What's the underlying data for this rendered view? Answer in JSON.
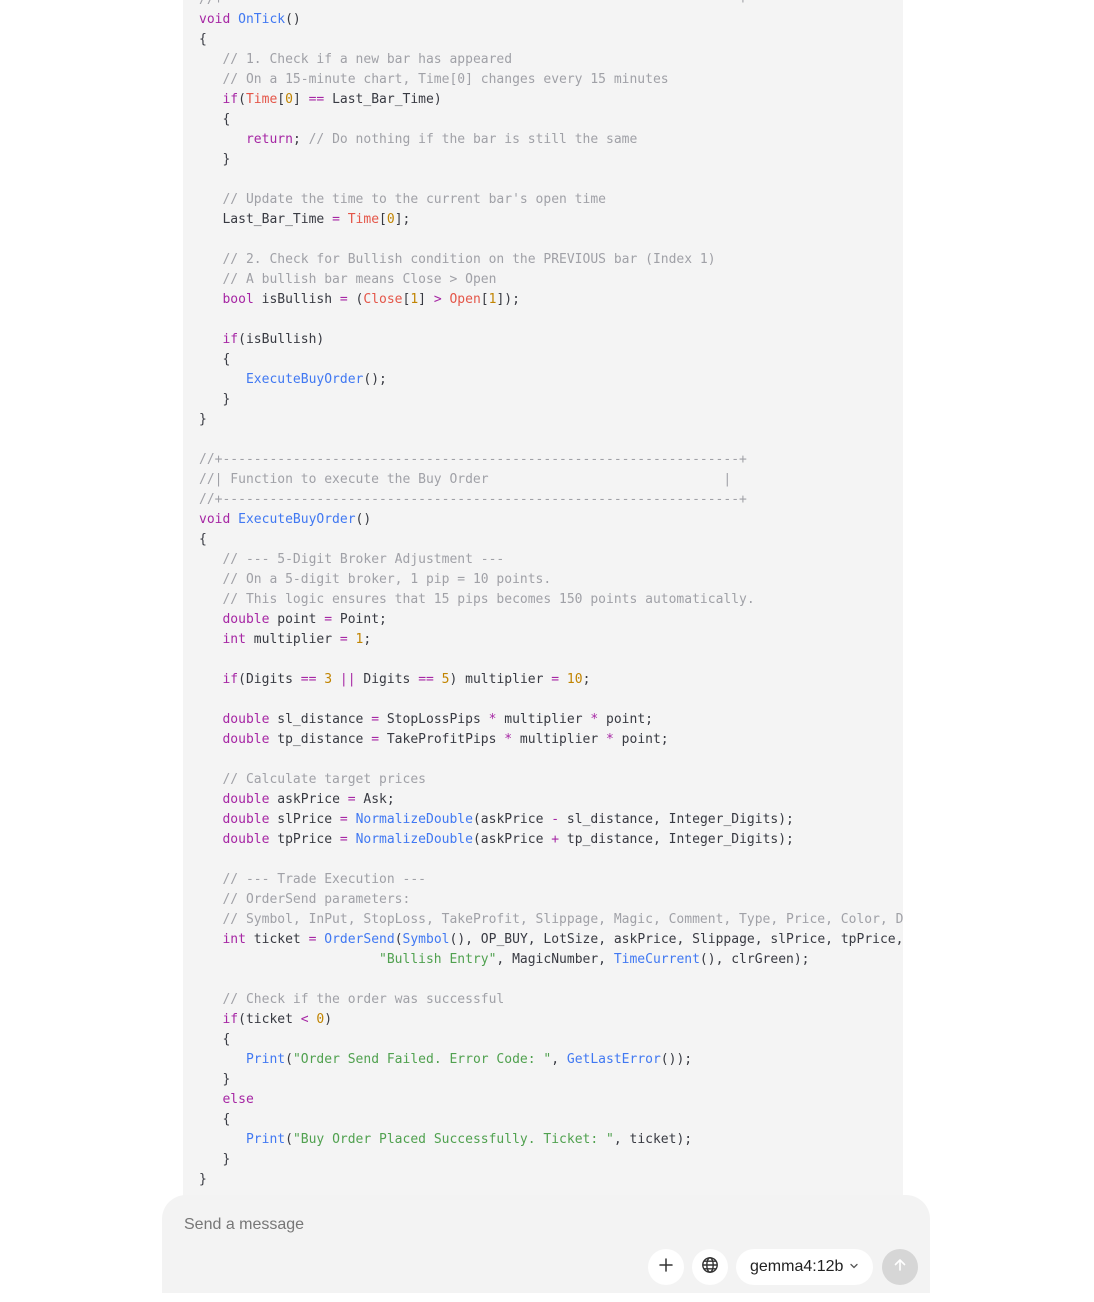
{
  "code_lines": [
    [
      [
        "c",
        "//+------------------------------------------------------------------+"
      ]
    ],
    [
      [
        "k",
        "void"
      ],
      [
        "t",
        " "
      ],
      [
        "f",
        "OnTick"
      ],
      [
        "t",
        "()"
      ]
    ],
    [
      [
        "t",
        "{"
      ]
    ],
    [
      [
        "t",
        "   "
      ],
      [
        "c",
        "// 1. Check if a new bar has appeared"
      ]
    ],
    [
      [
        "t",
        "   "
      ],
      [
        "c",
        "// On a 15-minute chart, Time[0] changes every 15 minutes"
      ]
    ],
    [
      [
        "t",
        "   "
      ],
      [
        "k",
        "if"
      ],
      [
        "t",
        "("
      ],
      [
        "v",
        "Time"
      ],
      [
        "t",
        "["
      ],
      [
        "n",
        "0"
      ],
      [
        "t",
        "] "
      ],
      [
        "o",
        "=="
      ],
      [
        "t",
        " Last_Bar_Time)"
      ]
    ],
    [
      [
        "t",
        "   {"
      ]
    ],
    [
      [
        "t",
        "      "
      ],
      [
        "k",
        "return"
      ],
      [
        "t",
        "; "
      ],
      [
        "c",
        "// Do nothing if the bar is still the same"
      ]
    ],
    [
      [
        "t",
        "   }"
      ]
    ],
    [
      [
        "t",
        ""
      ]
    ],
    [
      [
        "t",
        "   "
      ],
      [
        "c",
        "// Update the time to the current bar's open time"
      ]
    ],
    [
      [
        "t",
        "   Last_Bar_Time "
      ],
      [
        "o",
        "="
      ],
      [
        "t",
        " "
      ],
      [
        "v",
        "Time"
      ],
      [
        "t",
        "["
      ],
      [
        "n",
        "0"
      ],
      [
        "t",
        "];"
      ]
    ],
    [
      [
        "t",
        ""
      ]
    ],
    [
      [
        "t",
        "   "
      ],
      [
        "c",
        "// 2. Check for Bullish condition on the PREVIOUS bar (Index 1)"
      ]
    ],
    [
      [
        "t",
        "   "
      ],
      [
        "c",
        "// A bullish bar means Close > Open"
      ]
    ],
    [
      [
        "t",
        "   "
      ],
      [
        "k",
        "bool"
      ],
      [
        "t",
        " isBullish "
      ],
      [
        "o",
        "="
      ],
      [
        "t",
        " ("
      ],
      [
        "v",
        "Close"
      ],
      [
        "t",
        "["
      ],
      [
        "n",
        "1"
      ],
      [
        "t",
        "] "
      ],
      [
        "o",
        ">"
      ],
      [
        "t",
        " "
      ],
      [
        "v",
        "Open"
      ],
      [
        "t",
        "["
      ],
      [
        "n",
        "1"
      ],
      [
        "t",
        "]);"
      ]
    ],
    [
      [
        "t",
        ""
      ]
    ],
    [
      [
        "t",
        "   "
      ],
      [
        "k",
        "if"
      ],
      [
        "t",
        "(isBullish)"
      ]
    ],
    [
      [
        "t",
        "   {"
      ]
    ],
    [
      [
        "t",
        "      "
      ],
      [
        "f",
        "ExecuteBuyOrder"
      ],
      [
        "t",
        "();"
      ]
    ],
    [
      [
        "t",
        "   }"
      ]
    ],
    [
      [
        "t",
        "}"
      ]
    ],
    [
      [
        "t",
        ""
      ]
    ],
    [
      [
        "c",
        "//+------------------------------------------------------------------+"
      ]
    ],
    [
      [
        "c",
        "//| Function to execute the Buy Order                              |"
      ]
    ],
    [
      [
        "c",
        "//+------------------------------------------------------------------+"
      ]
    ],
    [
      [
        "k",
        "void"
      ],
      [
        "t",
        " "
      ],
      [
        "f",
        "ExecuteBuyOrder"
      ],
      [
        "t",
        "()"
      ]
    ],
    [
      [
        "t",
        "{"
      ]
    ],
    [
      [
        "t",
        "   "
      ],
      [
        "c",
        "// --- 5-Digit Broker Adjustment ---"
      ]
    ],
    [
      [
        "t",
        "   "
      ],
      [
        "c",
        "// On a 5-digit broker, 1 pip = 10 points."
      ]
    ],
    [
      [
        "t",
        "   "
      ],
      [
        "c",
        "// This logic ensures that 15 pips becomes 150 points automatically."
      ]
    ],
    [
      [
        "t",
        "   "
      ],
      [
        "k",
        "double"
      ],
      [
        "t",
        " point "
      ],
      [
        "o",
        "="
      ],
      [
        "t",
        " Point;"
      ]
    ],
    [
      [
        "t",
        "   "
      ],
      [
        "k",
        "int"
      ],
      [
        "t",
        " multiplier "
      ],
      [
        "o",
        "="
      ],
      [
        "t",
        " "
      ],
      [
        "n",
        "1"
      ],
      [
        "t",
        ";"
      ]
    ],
    [
      [
        "t",
        ""
      ]
    ],
    [
      [
        "t",
        "   "
      ],
      [
        "k",
        "if"
      ],
      [
        "t",
        "(Digits "
      ],
      [
        "o",
        "=="
      ],
      [
        "t",
        " "
      ],
      [
        "n",
        "3"
      ],
      [
        "t",
        " "
      ],
      [
        "o",
        "||"
      ],
      [
        "t",
        " Digits "
      ],
      [
        "o",
        "=="
      ],
      [
        "t",
        " "
      ],
      [
        "n",
        "5"
      ],
      [
        "t",
        ") multiplier "
      ],
      [
        "o",
        "="
      ],
      [
        "t",
        " "
      ],
      [
        "n",
        "10"
      ],
      [
        "t",
        ";"
      ]
    ],
    [
      [
        "t",
        ""
      ]
    ],
    [
      [
        "t",
        "   "
      ],
      [
        "k",
        "double"
      ],
      [
        "t",
        " sl_distance "
      ],
      [
        "o",
        "="
      ],
      [
        "t",
        " StopLossPips "
      ],
      [
        "o",
        "*"
      ],
      [
        "t",
        " multiplier "
      ],
      [
        "o",
        "*"
      ],
      [
        "t",
        " point;"
      ]
    ],
    [
      [
        "t",
        "   "
      ],
      [
        "k",
        "double"
      ],
      [
        "t",
        " tp_distance "
      ],
      [
        "o",
        "="
      ],
      [
        "t",
        " TakeProfitPips "
      ],
      [
        "o",
        "*"
      ],
      [
        "t",
        " multiplier "
      ],
      [
        "o",
        "*"
      ],
      [
        "t",
        " point;"
      ]
    ],
    [
      [
        "t",
        ""
      ]
    ],
    [
      [
        "t",
        "   "
      ],
      [
        "c",
        "// Calculate target prices"
      ]
    ],
    [
      [
        "t",
        "   "
      ],
      [
        "k",
        "double"
      ],
      [
        "t",
        " askPrice "
      ],
      [
        "o",
        "="
      ],
      [
        "t",
        " Ask;"
      ]
    ],
    [
      [
        "t",
        "   "
      ],
      [
        "k",
        "double"
      ],
      [
        "t",
        " slPrice "
      ],
      [
        "o",
        "="
      ],
      [
        "t",
        " "
      ],
      [
        "f",
        "NormalizeDouble"
      ],
      [
        "t",
        "(askPrice "
      ],
      [
        "o",
        "-"
      ],
      [
        "t",
        " sl_distance, Integer_Digits);"
      ]
    ],
    [
      [
        "t",
        "   "
      ],
      [
        "k",
        "double"
      ],
      [
        "t",
        " tpPrice "
      ],
      [
        "o",
        "="
      ],
      [
        "t",
        " "
      ],
      [
        "f",
        "NormalizeDouble"
      ],
      [
        "t",
        "(askPrice "
      ],
      [
        "o",
        "+"
      ],
      [
        "t",
        " tp_distance, Integer_Digits);"
      ]
    ],
    [
      [
        "t",
        ""
      ]
    ],
    [
      [
        "t",
        "   "
      ],
      [
        "c",
        "// --- Trade Execution ---"
      ]
    ],
    [
      [
        "t",
        "   "
      ],
      [
        "c",
        "// OrderSend parameters:"
      ]
    ],
    [
      [
        "t",
        "   "
      ],
      [
        "c",
        "// Symbol, InPut, StopLoss, TakeProfit, Slippage, Magic, Comment, Type, Price, Color, Dur"
      ]
    ],
    [
      [
        "t",
        "   "
      ],
      [
        "k",
        "int"
      ],
      [
        "t",
        " ticket "
      ],
      [
        "o",
        "="
      ],
      [
        "t",
        " "
      ],
      [
        "f",
        "OrderSend"
      ],
      [
        "t",
        "("
      ],
      [
        "f",
        "Symbol"
      ],
      [
        "t",
        "(), OP_BUY, LotSize, askPrice, Slippage, slPrice, tpPrice,"
      ]
    ],
    [
      [
        "t",
        "                       "
      ],
      [
        "s",
        "\"Bullish Entry\""
      ],
      [
        "t",
        ", MagicNumber, "
      ],
      [
        "f",
        "TimeCurrent"
      ],
      [
        "t",
        "(), clrGreen);"
      ]
    ],
    [
      [
        "t",
        ""
      ]
    ],
    [
      [
        "t",
        "   "
      ],
      [
        "c",
        "// Check if the order was successful"
      ]
    ],
    [
      [
        "t",
        "   "
      ],
      [
        "k",
        "if"
      ],
      [
        "t",
        "(ticket "
      ],
      [
        "o",
        "<"
      ],
      [
        "t",
        " "
      ],
      [
        "n",
        "0"
      ],
      [
        "t",
        ")"
      ]
    ],
    [
      [
        "t",
        "   {"
      ]
    ],
    [
      [
        "t",
        "      "
      ],
      [
        "f",
        "Print"
      ],
      [
        "t",
        "("
      ],
      [
        "s",
        "\"Order Send Failed. Error Code: \""
      ],
      [
        "t",
        ", "
      ],
      [
        "f",
        "GetLastError"
      ],
      [
        "t",
        "());"
      ]
    ],
    [
      [
        "t",
        "   }"
      ]
    ],
    [
      [
        "t",
        "   "
      ],
      [
        "k",
        "else"
      ]
    ],
    [
      [
        "t",
        "   {"
      ]
    ],
    [
      [
        "t",
        "      "
      ],
      [
        "f",
        "Print"
      ],
      [
        "t",
        "("
      ],
      [
        "s",
        "\"Buy Order Placed Successfully. Ticket: \""
      ],
      [
        "t",
        ", ticket);"
      ]
    ],
    [
      [
        "t",
        "   }"
      ]
    ],
    [
      [
        "t",
        "}"
      ]
    ]
  ],
  "composer": {
    "placeholder": "Send a message",
    "model_label": "gemma4:12b"
  },
  "colors": {
    "keyword": "#a626a4",
    "function": "#4078f2",
    "variable": "#e45649",
    "number": "#c18401",
    "string": "#50a14f",
    "comment": "#a0a1a7"
  }
}
